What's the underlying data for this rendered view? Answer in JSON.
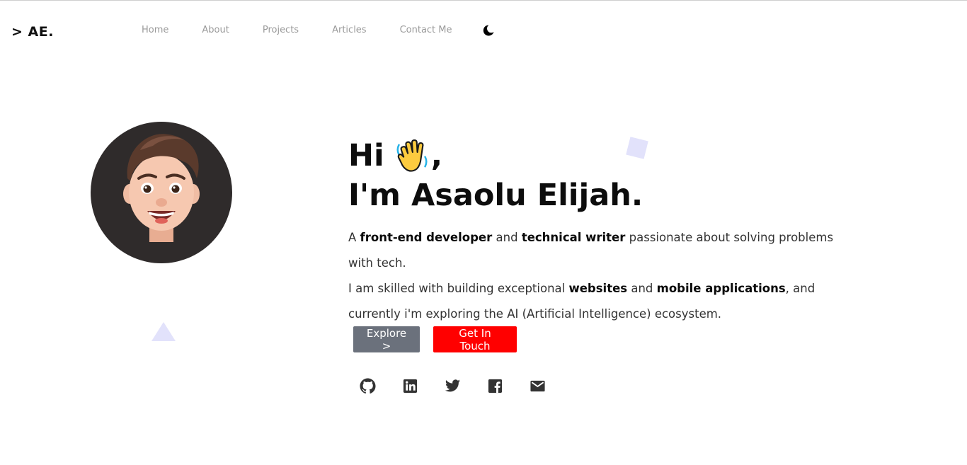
{
  "header": {
    "logo": "> AE.",
    "nav": [
      "Home",
      "About",
      "Projects",
      "Articles",
      "Contact Me"
    ],
    "theme_toggle_icon": "moon-icon"
  },
  "hero": {
    "greeting": "Hi",
    "greeting_suffix": ",",
    "wave_icon": "waving-hand-icon",
    "name": "I'm Asaolu Elijah.",
    "line1_a": "A ",
    "line1_b": "front-end developer",
    "line1_c": " and ",
    "line1_d": "technical writer",
    "line1_e": " passionate about solving problems with tech.",
    "line2_a": "I am skilled with building exceptional ",
    "line2_b": "websites",
    "line2_c": " and ",
    "line2_d": "mobile applications",
    "line2_e": ", and currently i'm exploring the AI (Artificial Intelligence) ecosystem."
  },
  "buttons": {
    "explore": "Explore >",
    "contact": "Get In Touch"
  },
  "socials": [
    "github-icon",
    "linkedin-icon",
    "twitter-icon",
    "facebook-icon",
    "email-icon"
  ],
  "colors": {
    "accent": "#ff0000",
    "explore_button": "#6b717c",
    "decoration": "#e2e2fb",
    "avatar_bg": "#2f2b2b"
  }
}
